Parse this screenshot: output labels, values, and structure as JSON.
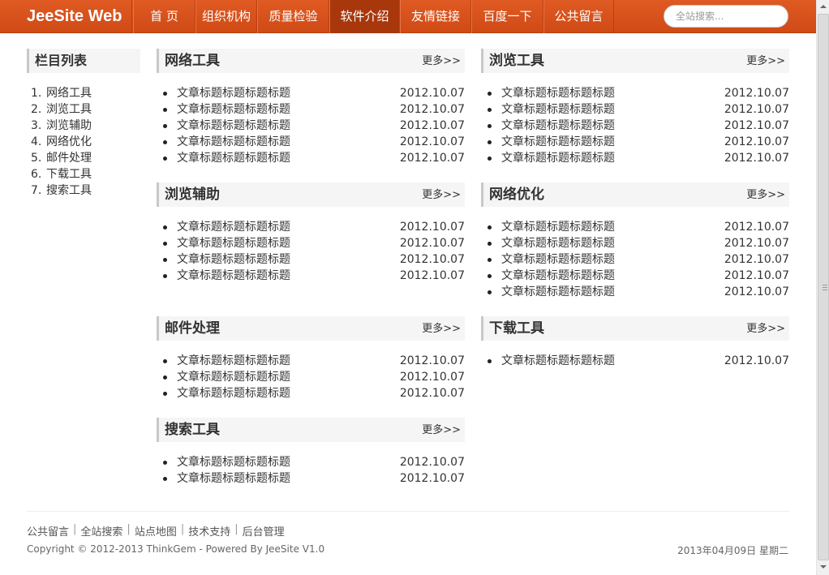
{
  "brand": "JeeSite Web",
  "nav": [
    "首 页",
    "组织机构",
    "质量检验",
    "软件介绍",
    "友情链接",
    "百度一下",
    "公共留言"
  ],
  "nav_active_index": 3,
  "search_placeholder": "全站搜索...",
  "sidebar": {
    "title": "栏目列表",
    "items": [
      {
        "num": "1.",
        "label": "网络工具"
      },
      {
        "num": "2.",
        "label": "浏览工具"
      },
      {
        "num": "3.",
        "label": "浏览辅助"
      },
      {
        "num": "4.",
        "label": "网络优化"
      },
      {
        "num": "5.",
        "label": "邮件处理"
      },
      {
        "num": "6.",
        "label": "下载工具"
      },
      {
        "num": "7.",
        "label": "搜索工具"
      }
    ]
  },
  "more_label": "更多>>",
  "panels": [
    {
      "title": "网络工具",
      "articles": [
        {
          "title": "文章标题标题标题标题",
          "date": "2012.10.07"
        },
        {
          "title": "文章标题标题标题标题",
          "date": "2012.10.07"
        },
        {
          "title": "文章标题标题标题标题",
          "date": "2012.10.07"
        },
        {
          "title": "文章标题标题标题标题",
          "date": "2012.10.07"
        },
        {
          "title": "文章标题标题标题标题",
          "date": "2012.10.07"
        }
      ]
    },
    {
      "title": "浏览工具",
      "articles": [
        {
          "title": "文章标题标题标题标题",
          "date": "2012.10.07"
        },
        {
          "title": "文章标题标题标题标题",
          "date": "2012.10.07"
        },
        {
          "title": "文章标题标题标题标题",
          "date": "2012.10.07"
        },
        {
          "title": "文章标题标题标题标题",
          "date": "2012.10.07"
        },
        {
          "title": "文章标题标题标题标题",
          "date": "2012.10.07"
        }
      ]
    },
    {
      "title": "浏览辅助",
      "articles": [
        {
          "title": "文章标题标题标题标题",
          "date": "2012.10.07"
        },
        {
          "title": "文章标题标题标题标题",
          "date": "2012.10.07"
        },
        {
          "title": "文章标题标题标题标题",
          "date": "2012.10.07"
        },
        {
          "title": "文章标题标题标题标题",
          "date": "2012.10.07"
        }
      ]
    },
    {
      "title": "网络优化",
      "articles": [
        {
          "title": "文章标题标题标题标题",
          "date": "2012.10.07"
        },
        {
          "title": "文章标题标题标题标题",
          "date": "2012.10.07"
        },
        {
          "title": "文章标题标题标题标题",
          "date": "2012.10.07"
        },
        {
          "title": "文章标题标题标题标题",
          "date": "2012.10.07"
        },
        {
          "title": "文章标题标题标题标题",
          "date": "2012.10.07"
        }
      ]
    },
    {
      "title": "邮件处理",
      "articles": [
        {
          "title": "文章标题标题标题标题",
          "date": "2012.10.07"
        },
        {
          "title": "文章标题标题标题标题",
          "date": "2012.10.07"
        },
        {
          "title": "文章标题标题标题标题",
          "date": "2012.10.07"
        }
      ]
    },
    {
      "title": "下载工具",
      "articles": [
        {
          "title": "文章标题标题标题标题",
          "date": "2012.10.07"
        }
      ]
    },
    {
      "title": "搜索工具",
      "articles": [
        {
          "title": "文章标题标题标题标题",
          "date": "2012.10.07"
        },
        {
          "title": "文章标题标题标题标题",
          "date": "2012.10.07"
        }
      ]
    }
  ],
  "footer": {
    "links": [
      "公共留言",
      "全站搜索",
      "站点地图",
      "技术支持",
      "后台管理"
    ],
    "copyright": "Copyright © 2012-2013 ThinkGem - Powered By JeeSite V1.0",
    "date": "2013年04月09日 星期二"
  }
}
